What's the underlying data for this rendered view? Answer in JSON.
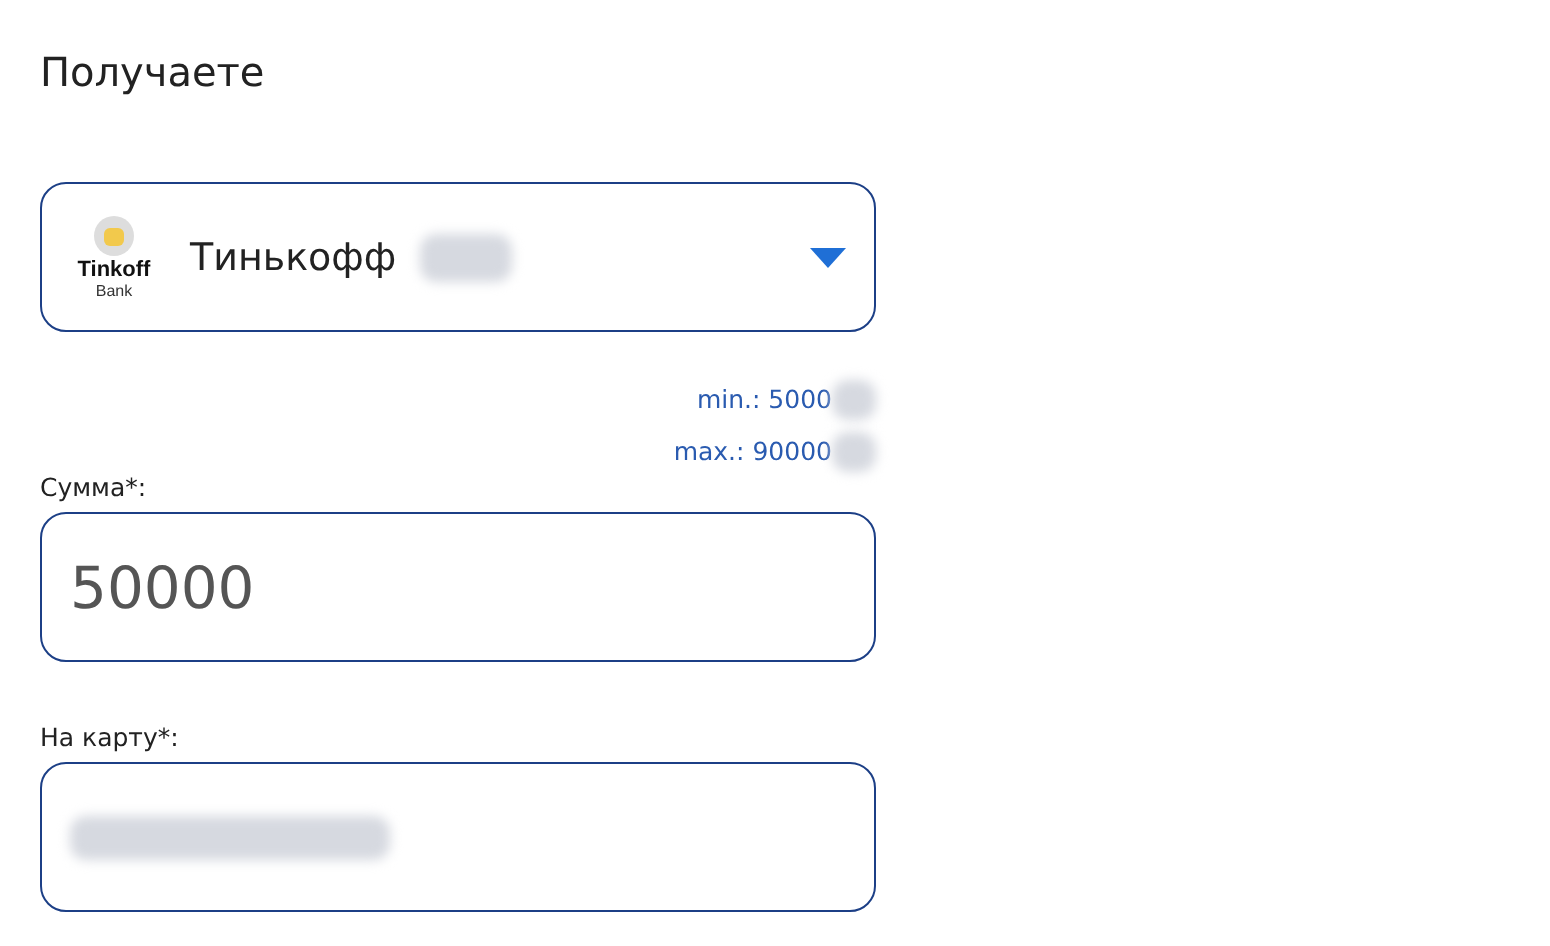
{
  "title": "Получаете",
  "bank_select": {
    "logo": {
      "name": "Tinkoff",
      "subtitle": "Bank"
    },
    "value": "Тинькофф",
    "redacted": true
  },
  "limits": [
    {
      "text": "min.: 5000",
      "redacted": true
    },
    {
      "text": "max.: 90000",
      "redacted": true
    }
  ],
  "fields": [
    {
      "label": "Сумма*:",
      "value": "50000",
      "redacted": false
    },
    {
      "label": "На карту*:",
      "redacted": true
    }
  ]
}
